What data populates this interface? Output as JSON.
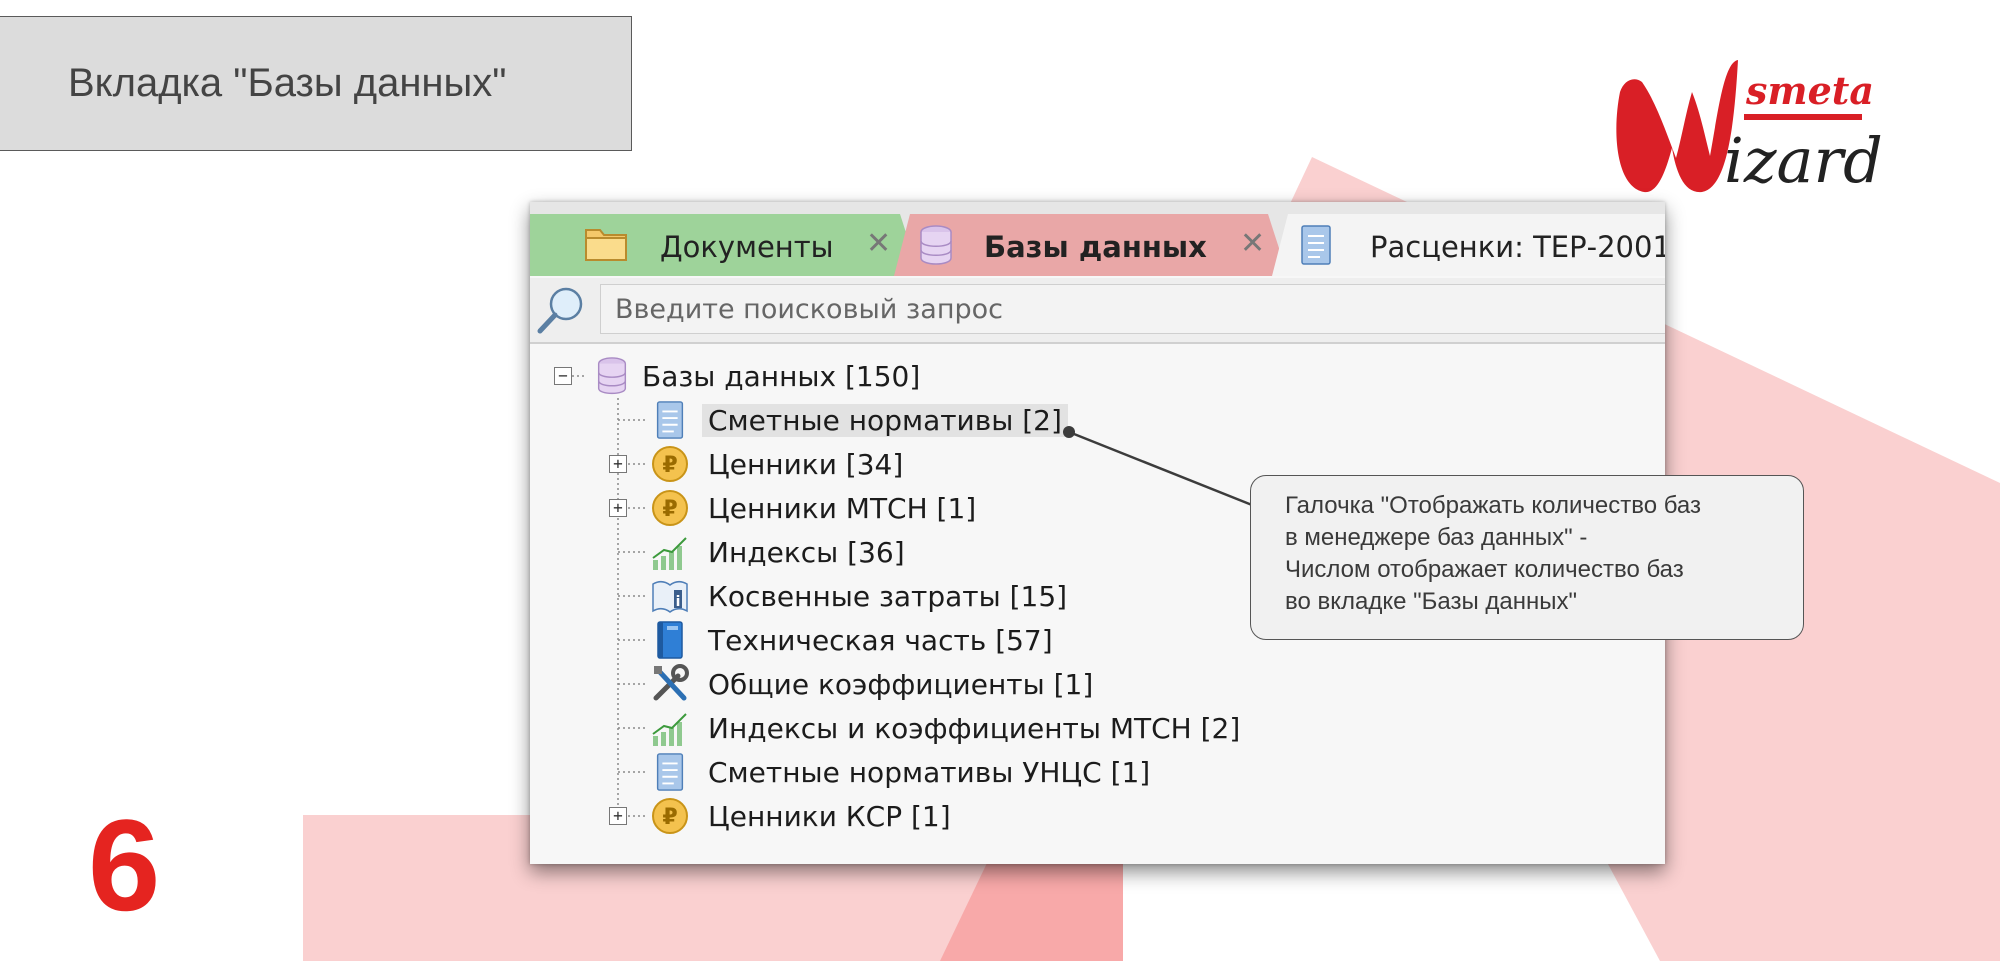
{
  "slide": {
    "title": "Вкладка \"Базы данных\"",
    "number": "6",
    "accent_color": "#e52420"
  },
  "logo": {
    "small_text": "smeta",
    "big_text": "izard",
    "initial": "W"
  },
  "tabs": [
    {
      "label": "Документы",
      "icon": "folder-icon",
      "color": "#9ed39a",
      "close": "✕"
    },
    {
      "label": "Базы данных",
      "icon": "database-icon",
      "color": "#e9a7a7",
      "close": "✕",
      "active": true
    },
    {
      "label": "Расценки: ТЕР-2001",
      "icon": "document-icon",
      "color": "#f4f4f4"
    }
  ],
  "search": {
    "placeholder": "Введите поисковый запрос",
    "icon": "magnifier-icon"
  },
  "tree": {
    "root": {
      "label": "Базы данных [150]",
      "icon": "database-icon",
      "expander": "−"
    },
    "items": [
      {
        "label": "Сметные нормативы [2]",
        "icon": "document-icon",
        "selected": true
      },
      {
        "label": "Ценники [34]",
        "icon": "ruble-coin-icon",
        "expander": "+"
      },
      {
        "label": "Ценники МТСН [1]",
        "icon": "ruble-coin-icon",
        "expander": "+"
      },
      {
        "label": "Индексы [36]",
        "icon": "bar-chart-icon"
      },
      {
        "label": "Косвенные затраты [15]",
        "icon": "info-book-icon"
      },
      {
        "label": "Техническая часть [57]",
        "icon": "blue-book-icon"
      },
      {
        "label": "Общие коэффициенты [1]",
        "icon": "tools-icon"
      },
      {
        "label": "Индексы и коэффициенты МТСН [2]",
        "icon": "bar-chart-icon"
      },
      {
        "label": "Сметные нормативы УНЦС [1]",
        "icon": "document-icon"
      },
      {
        "label": "Ценники КСР [1]",
        "icon": "ruble-coin-icon",
        "expander": "+"
      }
    ]
  },
  "callout": {
    "lines": [
      "Галочка \"Отображать количество баз",
      "в менеджере баз данных\" -",
      "Числом отображает количество баз",
      "во вкладке \"Базы данных\""
    ]
  }
}
